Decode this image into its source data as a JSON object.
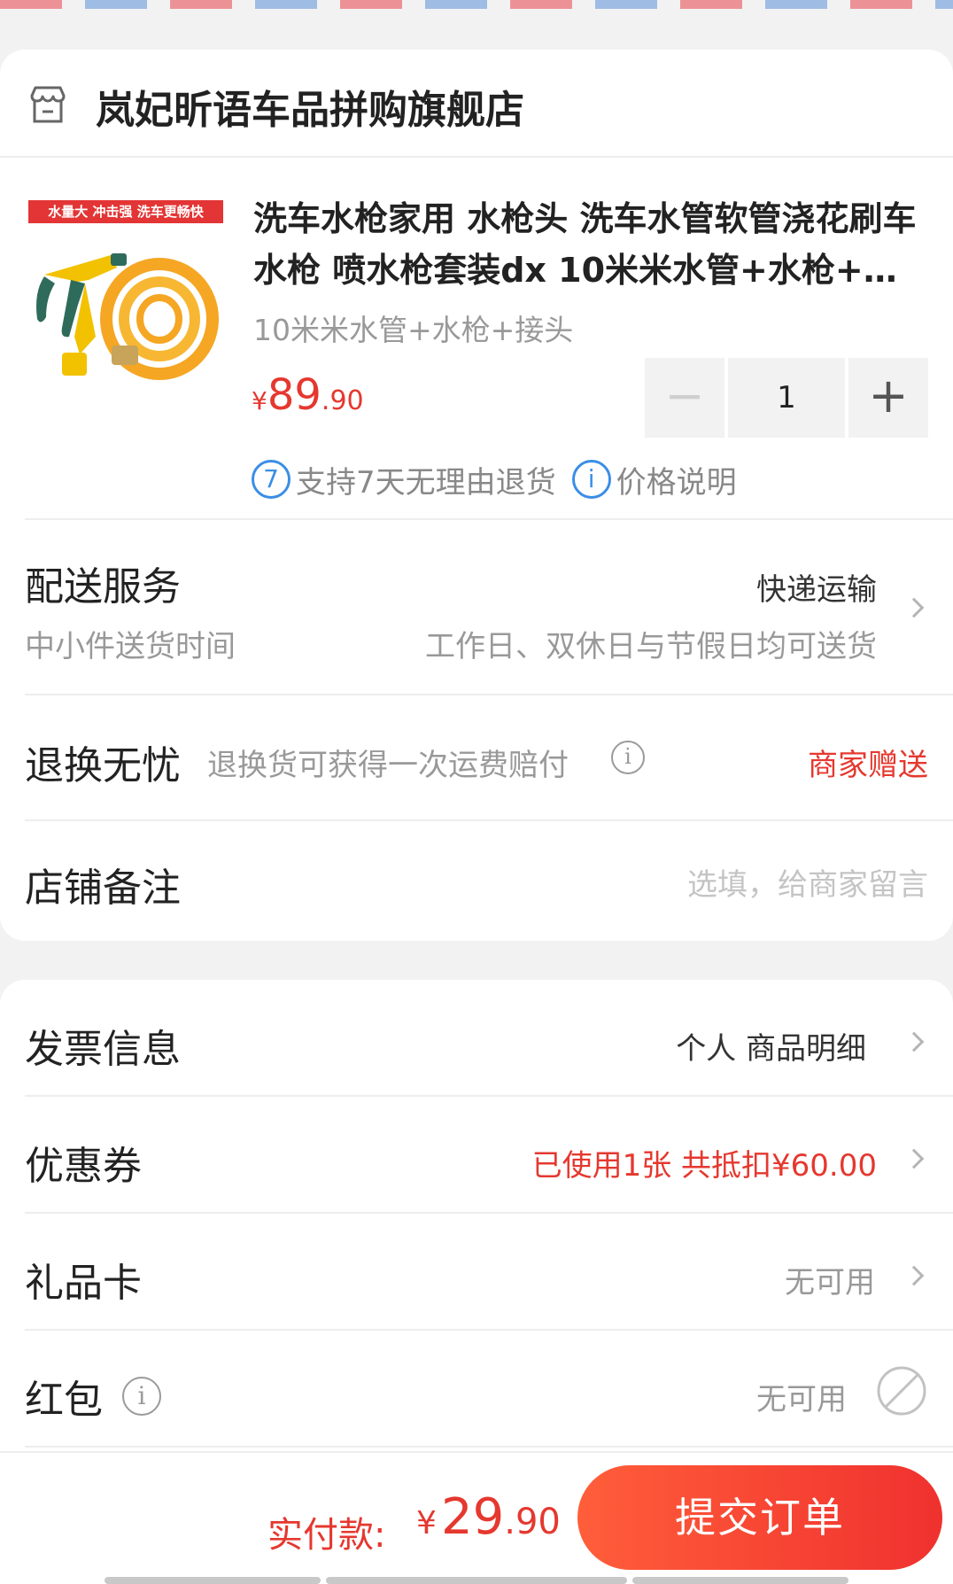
{
  "shop": {
    "name": "岚妃昕语车品拼购旗舰店",
    "product": {
      "title": "洗车水枪家用 水枪头 洗车水管软管浇花刷车水枪 喷水枪套装dx 10米米水管+水枪+接头",
      "image_banner": "水量大 冲击强 洗车更畅快",
      "spec": "10米米水管+水枪+接头",
      "price_symbol": "¥",
      "price_integer": "89",
      "price_decimal": ".90",
      "quantity": "1",
      "minus_label": "−",
      "plus_label": "+"
    },
    "guarantees": {
      "return_badge": "7",
      "return_text": "支持7天无理由退货",
      "info_badge": "i",
      "price_text": "价格说明"
    },
    "delivery": {
      "title": "配送服务",
      "method": "快递运输",
      "time_label": "中小件送货时间",
      "time_value": "工作日、双休日与节假日均可送货"
    },
    "return_worry": {
      "title": "退换无忧",
      "desc": "退换货可获得一次运费赔付",
      "info_badge": "i",
      "value": "商家赠送"
    },
    "remark": {
      "title": "店铺备注",
      "placeholder": "选填，给商家留言"
    }
  },
  "invoice": {
    "title": "发票信息",
    "value": "个人  商品明细"
  },
  "coupon": {
    "title": "优惠券",
    "value": "已使用1张 共抵扣¥60.00"
  },
  "gift_card": {
    "title": "礼品卡",
    "value": "无可用"
  },
  "red_packet": {
    "title": "红包",
    "info_badge": "i",
    "value": "无可用"
  },
  "footer": {
    "pay_label": "实付款:",
    "pay_symbol": "¥",
    "pay_integer": "29",
    "pay_decimal": ".90",
    "submit_label": "提交订单"
  },
  "colors": {
    "accent_red": "#e5382f",
    "info_blue": "#3a8ee6",
    "muted_text": "#999999"
  }
}
